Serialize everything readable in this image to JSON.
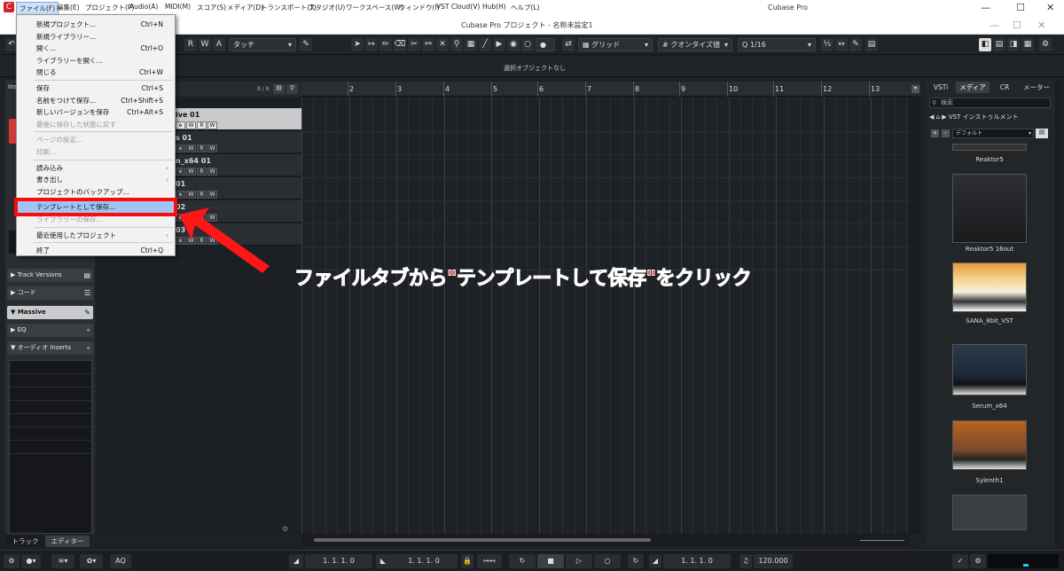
{
  "app": {
    "title": "Cubase Pro",
    "project_title": "Cubase Pro プロジェクト - 名称未設定1"
  },
  "menubar": {
    "items": [
      "ファイル(F)",
      "編集(E)",
      "プロジェクト(P)",
      "Audio(A)",
      "MIDI(M)",
      "スコア(S)",
      "メディア(D)",
      "トランスポート(T)",
      "スタジオ(U)",
      "ワークスペース(W)",
      "ウィンドウ(I)",
      "VST Cloud(V)",
      "Hub(H)",
      "ヘルプ(L)"
    ]
  },
  "file_menu": {
    "items": [
      {
        "label": "新規プロジェクト...",
        "shortcut": "Ctrl+N",
        "disabled": false
      },
      {
        "label": "新規ライブラリー...",
        "shortcut": "",
        "disabled": false
      },
      {
        "label": "開く...",
        "shortcut": "Ctrl+O",
        "disabled": false
      },
      {
        "label": "ライブラリーを開く...",
        "shortcut": "",
        "disabled": false
      },
      {
        "label": "閉じる",
        "shortcut": "Ctrl+W",
        "disabled": false
      },
      {
        "label": "保存",
        "shortcut": "Ctrl+S",
        "disabled": false
      },
      {
        "label": "名前をつけて保存...",
        "shortcut": "Ctrl+Shift+S",
        "disabled": false
      },
      {
        "label": "新しいバージョンを保存",
        "shortcut": "Ctrl+Alt+S",
        "disabled": false
      },
      {
        "label": "最後に保存した状態に戻す",
        "shortcut": "",
        "disabled": true
      },
      {
        "label": "ページの設定...",
        "shortcut": "",
        "disabled": true
      },
      {
        "label": "印刷...",
        "shortcut": "",
        "disabled": true
      },
      {
        "label": "読み込み",
        "shortcut": "",
        "disabled": false,
        "submenu": true
      },
      {
        "label": "書き出し",
        "shortcut": "",
        "disabled": false,
        "submenu": true
      },
      {
        "label": "プロジェクトのバックアップ...",
        "shortcut": "",
        "disabled": false
      },
      {
        "label": "テンプレートとして保存...",
        "shortcut": "",
        "disabled": false,
        "highlighted": true
      },
      {
        "label": "ライブラリーの保存...",
        "shortcut": "",
        "disabled": true
      },
      {
        "label": "最近使用したプロジェクト",
        "shortcut": "",
        "disabled": false,
        "submenu": true
      },
      {
        "label": "終了",
        "shortcut": "Ctrl+Q",
        "disabled": false
      }
    ]
  },
  "toolbar": {
    "automation_letters": [
      "R",
      "W",
      "A"
    ],
    "automation_mode": "タッチ",
    "snap_type": "グリッド",
    "quantize_label": "クオンタイズ値",
    "quantize_value": "1/16"
  },
  "infobar": {
    "selection": "選択オブジェクトなし"
  },
  "inspector": {
    "title": "Insp",
    "sections": [
      {
        "label": "Track Versions"
      },
      {
        "label": "コード"
      },
      {
        "label": "Massive"
      },
      {
        "label": "EQ"
      },
      {
        "label": "オーディオ Inserts"
      }
    ],
    "tabs": [
      "トラック",
      "エディター"
    ]
  },
  "tracklist": {
    "count": "8 / 8",
    "tracks": [
      {
        "name": "ive 01",
        "selected": true
      },
      {
        "name": "s 01",
        "selected": false
      },
      {
        "name": "n_x64 01",
        "selected": false
      },
      {
        "name": "01",
        "selected": false
      },
      {
        "name": "02",
        "selected": false
      },
      {
        "name": "03",
        "selected": false
      }
    ],
    "track_buttons": [
      "e",
      "W",
      "R",
      "W"
    ]
  },
  "ruler": {
    "bars": [
      "2",
      "3",
      "4",
      "5",
      "6",
      "7",
      "8",
      "9",
      "10",
      "11",
      "12",
      "13"
    ]
  },
  "rack": {
    "tabs": [
      "VSTi",
      "メディア",
      "CR",
      "メーター"
    ],
    "search_placeholder": "検索",
    "breadcrumb": "VST インストゥルメント",
    "preset": "デフォルト",
    "plugins": [
      "Reaktor5",
      "Reaktor5 16out",
      "SANA_8bit_VST",
      "Serum_x64",
      "Sylenth1"
    ]
  },
  "transport": {
    "left_locator": "1. 1. 1.  0",
    "right_locator": "1. 1. 1.  0",
    "position": "1. 1. 1.  0",
    "tempo": "120.000",
    "aq": "AQ"
  },
  "annotation": {
    "text": "ファイルタブから\"テンプレートして保存\"をクリック"
  },
  "colors": {
    "highlight_box": "#ff0a0a",
    "annotation_text": "#ff1616",
    "menu_highlight": "#9ec5f3",
    "background": "#1e2125"
  }
}
